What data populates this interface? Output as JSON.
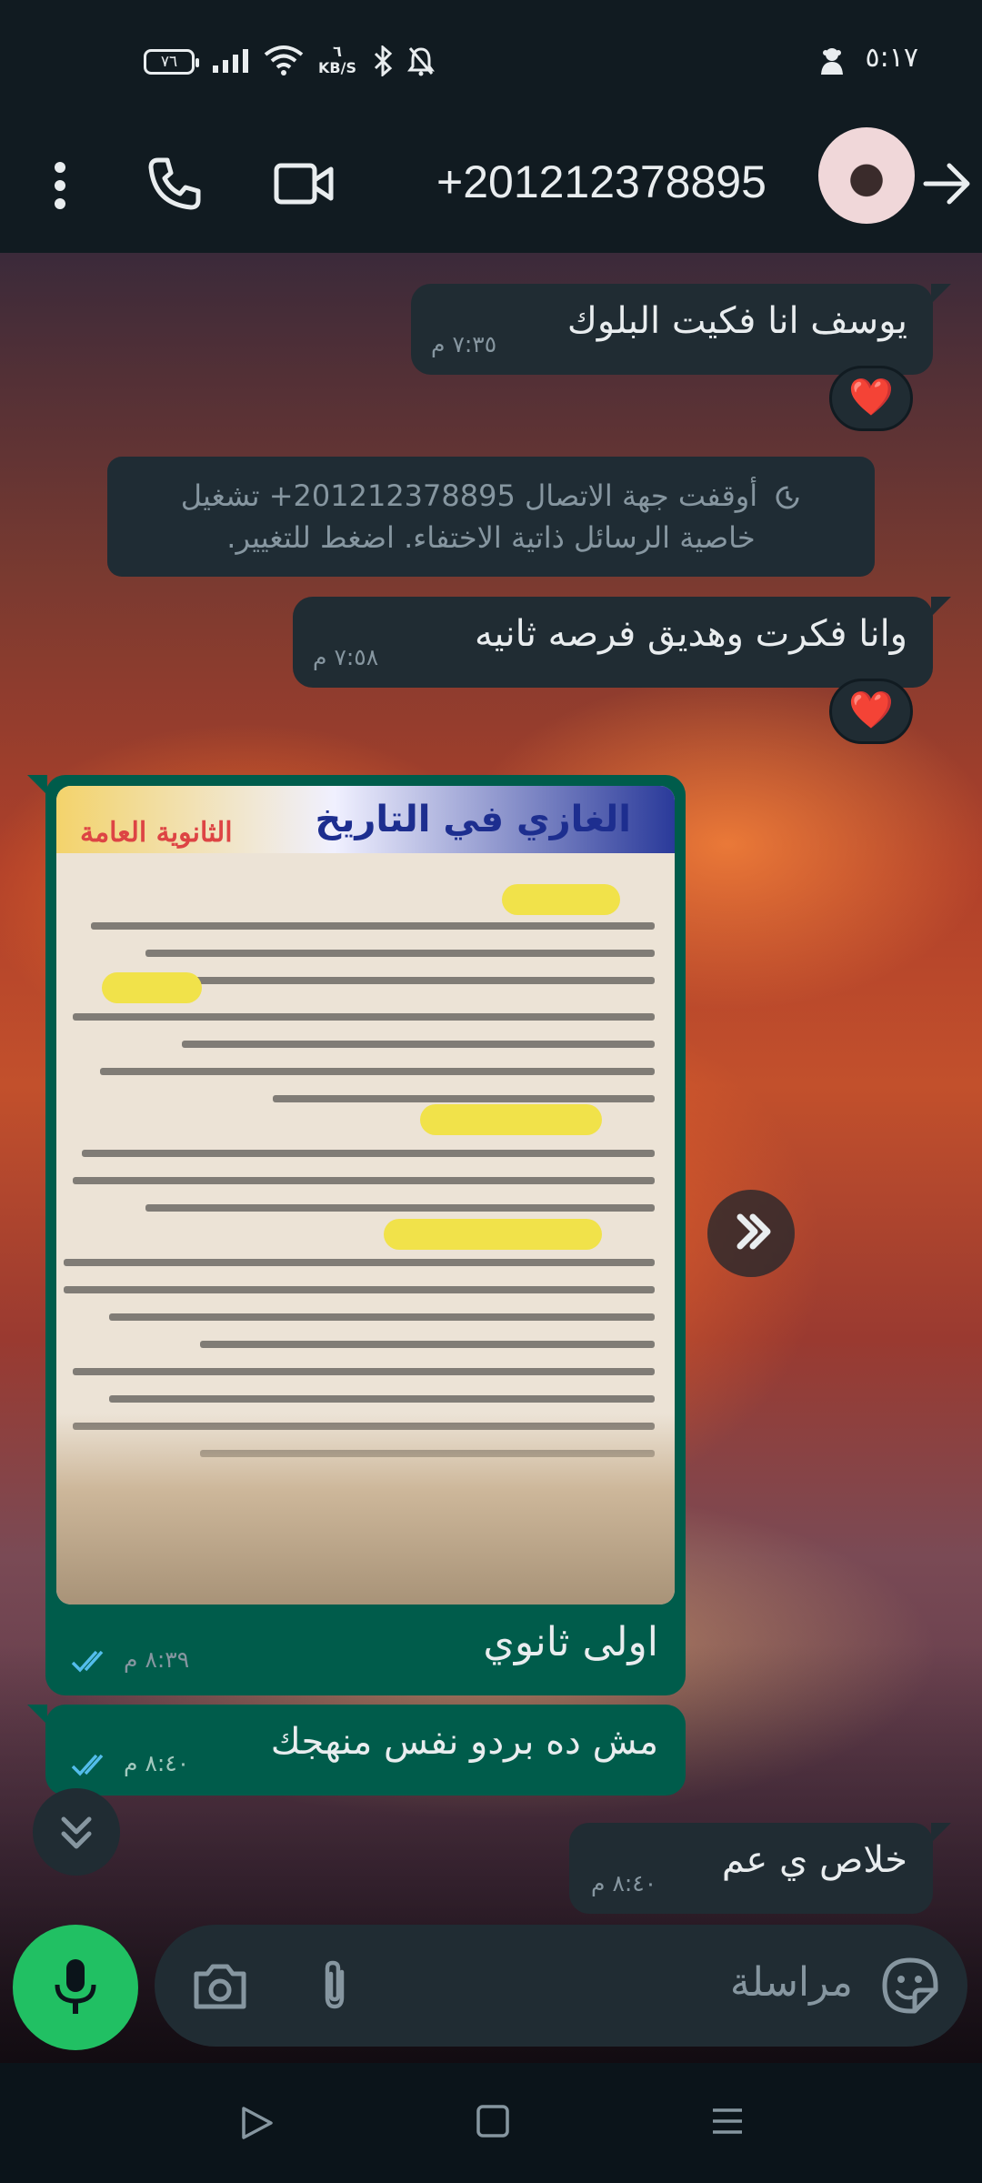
{
  "status_bar": {
    "time": "٥:١٧",
    "battery": "٧٦",
    "net_speed_value": "٦",
    "net_speed_unit": "KB/S"
  },
  "header": {
    "contact_name": "+201212378895",
    "icons": [
      "more-vert-icon",
      "phone-icon",
      "video-icon",
      "back-arrow-icon"
    ]
  },
  "messages": [
    {
      "direction": "incoming",
      "text": "يوسف انا فكيت البلوك",
      "time": "٧:٣٥ م",
      "reaction": "❤️"
    },
    {
      "direction": "system",
      "text_line1": "أوقفت جهة الاتصال ‎+201212378895 تشغيل",
      "text_line2": "خاصية الرسائل ذاتية الاختفاء. اضغط للتغيير."
    },
    {
      "direction": "incoming",
      "text": "وانا فكرت وهديق فرصه ثانيه",
      "time": "٧:٥٨ م",
      "reaction": "❤️"
    },
    {
      "direction": "outgoing",
      "type": "image",
      "caption": "اولى ثانوي",
      "time": "٨:٣٩ م",
      "image_text": {
        "title": "الغازي في التاريخ",
        "badge": "الثانوية العامة"
      }
    },
    {
      "direction": "outgoing",
      "text": "مش ده بردو نفس منهجك",
      "time": "٨:٤٠ م"
    },
    {
      "direction": "incoming",
      "text": "خلاص ي عم",
      "time": "٨:٤٠ م"
    }
  ],
  "compose": {
    "placeholder": "مراسلة"
  },
  "colors": {
    "incoming_bubble": "#202c33",
    "outgoing_bubble": "#005c4b",
    "accent_green": "#21c063",
    "read_ticks": "#53bdeb",
    "header_bg": "#111b21"
  }
}
